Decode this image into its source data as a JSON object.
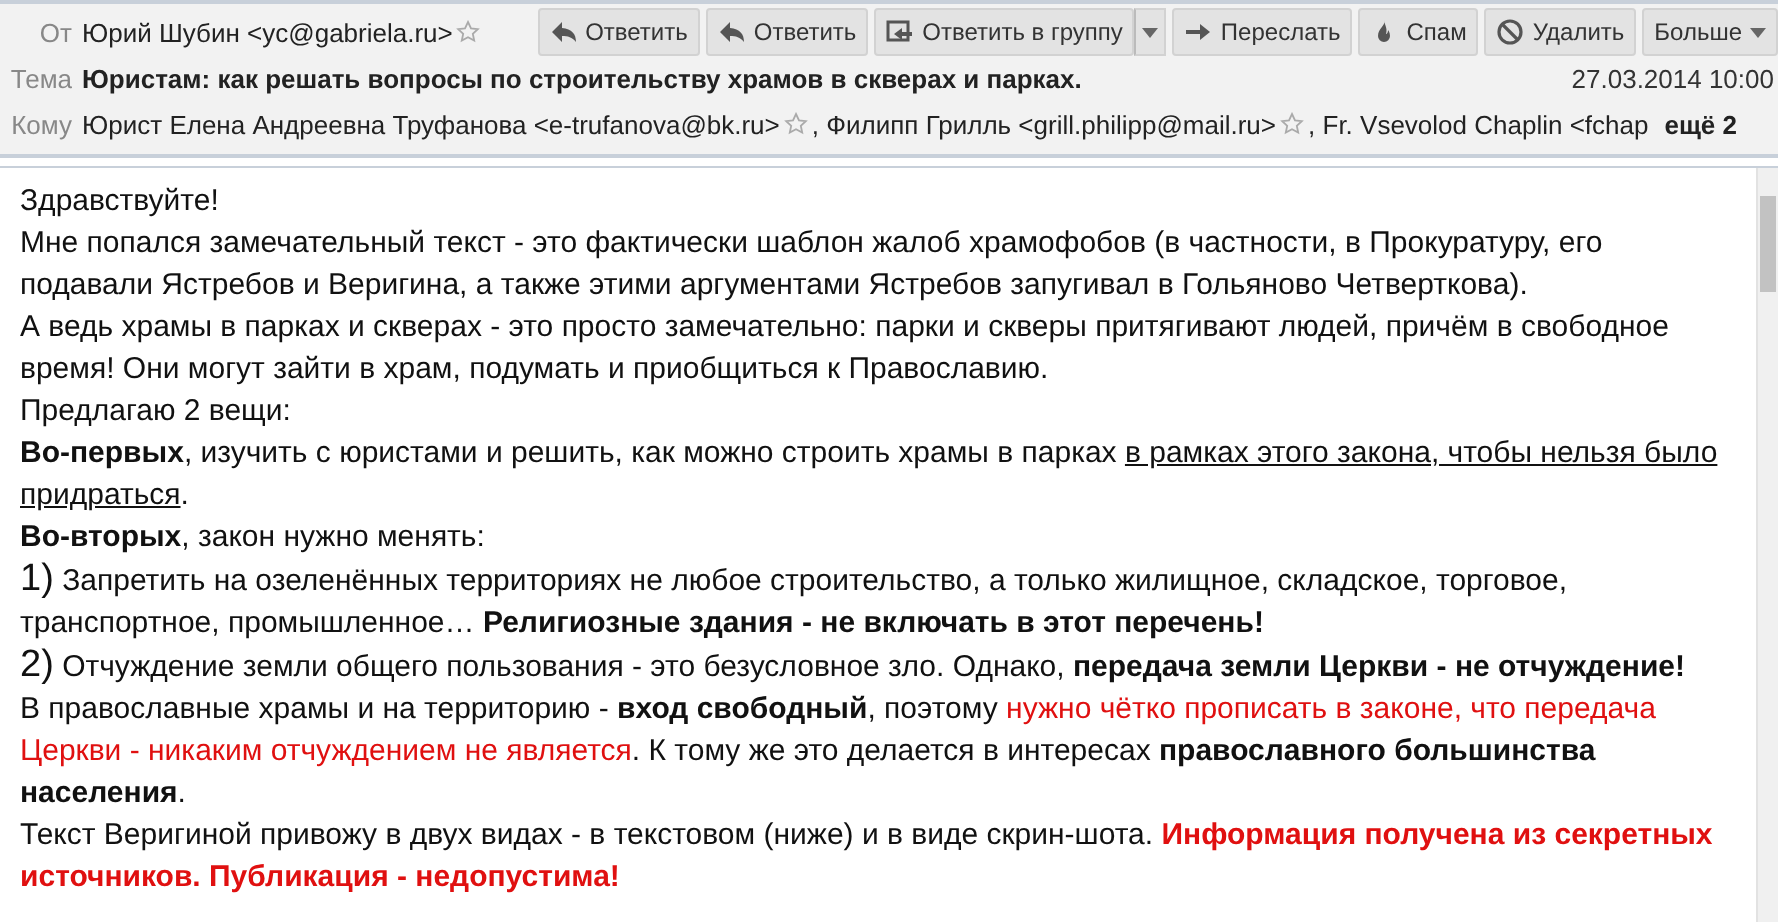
{
  "header": {
    "from": {
      "label": "От",
      "value": "Юрий Шубин <yc@gabriela.ru>"
    },
    "toolbar": [
      {
        "label": "Ответить",
        "kind": "reply"
      },
      {
        "label": "Ответить",
        "kind": "reply"
      },
      {
        "label": "Ответить в группу",
        "kind": "reply_all"
      },
      {
        "label": "Переслать",
        "kind": "forward"
      },
      {
        "label": "Спам",
        "kind": "spam"
      },
      {
        "label": "Удалить",
        "kind": "delete"
      },
      {
        "label": "Больше",
        "kind": "more"
      }
    ],
    "subject": {
      "label": "Тема",
      "value": "Юристам: как решать вопросы по строительству храмов в скверах и парках.",
      "date": "27.03.2014 10:00"
    },
    "to": {
      "label": "Кому",
      "recipients": [
        "Юрист Елена Андреевна Труфанова <e-trufanova@bk.ru>",
        "Филипп Грилль <grill.philipp@mail.ru>",
        "Fr. Vsevolod Chaplin <fchap"
      ],
      "separator": ",",
      "more": "ещё 2"
    }
  },
  "body": [
    [
      {
        "text": "Здравствуйте!",
        "kind": "plain"
      }
    ],
    [
      {
        "text": "Мне попался замечательный текст - это фактически шаблон жалоб храмофобов (в частности, в Прокуратуру, его подавали Ястребов и Веригина, а также этими аргументами Ястребов запугивал в Гольяново Четверткова).",
        "kind": "plain"
      }
    ],
    [
      {
        "text": "А ведь храмы в парках и скверах - это просто замечательно: парки и скверы притягивают людей, причём в свободное время! Они могут зайти в храм, подумать и приобщиться к Православию.",
        "kind": "plain"
      }
    ],
    [
      {
        "text": "Предлагаю 2 вещи:",
        "kind": "plain"
      }
    ],
    [
      {
        "text": "Во-первых",
        "kind": "bold"
      },
      {
        "text": ", изучить с юристами и решить, как можно строить храмы в парках ",
        "kind": "plain"
      },
      {
        "text": "в рамках этого закона, чтобы нельзя было придраться",
        "kind": "underline"
      },
      {
        "text": ".",
        "kind": "plain"
      }
    ],
    [
      {
        "text": "Во-вторых",
        "kind": "bold"
      },
      {
        "text": ", закон нужно менять:",
        "kind": "plain"
      }
    ],
    [
      {
        "text": "1)",
        "kind": "big"
      },
      {
        "text": " Запретить на озеленённых территориях не любое строительство, а только жилищное, складское, торговое, транспортное, промышленное… ",
        "kind": "plain"
      },
      {
        "text": "Религиозные здания - не включать в этот перечень!",
        "kind": "bold"
      }
    ],
    [
      {
        "text": "2)",
        "kind": "big"
      },
      {
        "text": " Отчуждение земли общего пользования - это безусловное зло. Однако, ",
        "kind": "plain"
      },
      {
        "text": "передача земли Церкви - не отчуждение!",
        "kind": "bold"
      }
    ],
    [
      {
        "text": "В православные храмы и на территорию - ",
        "kind": "plain"
      },
      {
        "text": "вход свободный",
        "kind": "bold"
      },
      {
        "text": ", поэтому ",
        "kind": "plain"
      },
      {
        "text": "нужно чётко прописать в законе, что передача Церкви - никаким отчуждением не является",
        "kind": "red"
      },
      {
        "text": ". К тому  же это делается в интересах ",
        "kind": "plain"
      },
      {
        "text": "православного большинства населения",
        "kind": "bold"
      },
      {
        "text": ".",
        "kind": "plain"
      }
    ],
    [
      {
        "text": "Текст Веригиной привожу в двух видах - в текстовом (ниже) и в виде скрин-шота. ",
        "kind": "plain"
      },
      {
        "text": "Информация получена из секретных источников. Публикация - недопустима!",
        "kind": "red_bold"
      }
    ]
  ]
}
